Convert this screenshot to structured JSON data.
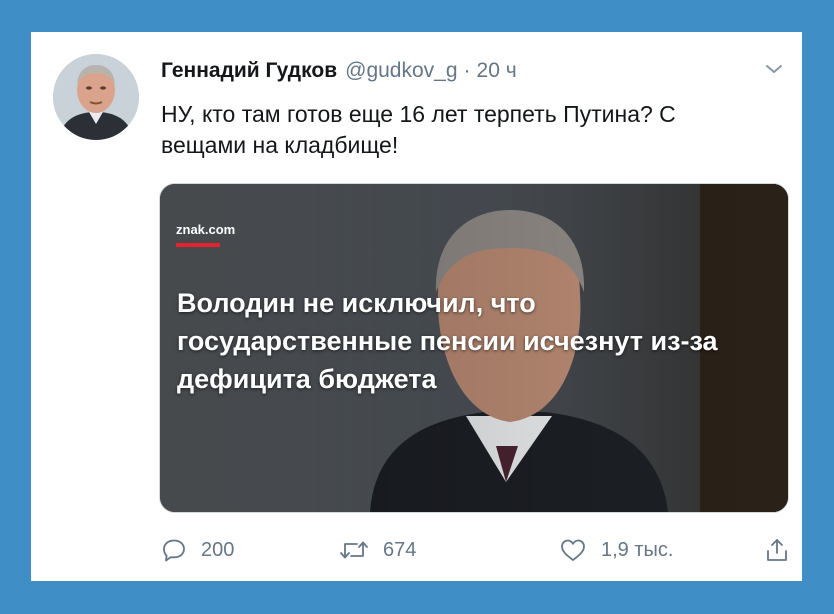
{
  "tweet": {
    "author_name": "Геннадий Гудков",
    "handle": "@gudkov_g",
    "separator": "·",
    "time": "20 ч",
    "text": "НУ, кто там готов еще 16 лет терпеть Путина? С вещами на кладбище!",
    "avatar_icon": "person-photo"
  },
  "media": {
    "source": "znak.com",
    "headline": "Володин не исключил, что государственные пенсии исчезнут из-за дефицита бюджета",
    "accent_color": "#e3222d"
  },
  "actions": {
    "replies": "200",
    "retweets": "674",
    "likes": "1,9 тыс."
  },
  "colors": {
    "background": "#3f8fc6",
    "card": "#ffffff",
    "text": "#14171a",
    "muted": "#657786"
  }
}
